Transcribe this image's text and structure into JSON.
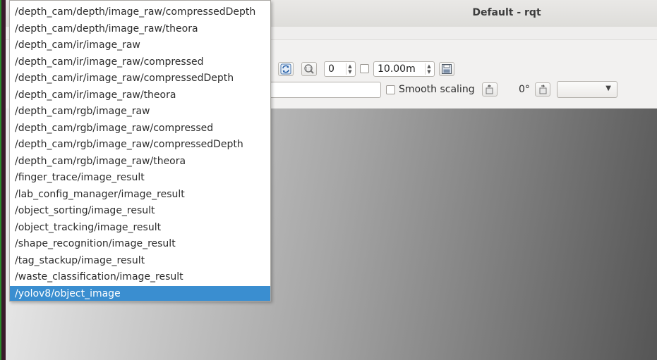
{
  "window": {
    "title": "Default - rqt"
  },
  "toolbar": {
    "refresh_icon": "refresh-icon",
    "zoom_icon": "zoom-icon",
    "spin_value": "0",
    "duration_value": "10.00m",
    "save_icon": "save-icon",
    "smooth_scaling_label": "Smooth scaling",
    "rotate_left_icon": "rotate-left-icon",
    "rotation_label": "0°",
    "rotate_right_icon": "rotate-right-icon",
    "combo_value": ""
  },
  "topic_dropdown": {
    "items": [
      "/depth_cam/depth/image_raw/compressedDepth",
      "/depth_cam/depth/image_raw/theora",
      "/depth_cam/ir/image_raw",
      "/depth_cam/ir/image_raw/compressed",
      "/depth_cam/ir/image_raw/compressedDepth",
      "/depth_cam/ir/image_raw/theora",
      "/depth_cam/rgb/image_raw",
      "/depth_cam/rgb/image_raw/compressed",
      "/depth_cam/rgb/image_raw/compressedDepth",
      "/depth_cam/rgb/image_raw/theora",
      "/finger_trace/image_result",
      "/lab_config_manager/image_result",
      "/object_sorting/image_result",
      "/object_tracking/image_result",
      "/shape_recognition/image_result",
      "/tag_stackup/image_result",
      "/waste_classification/image_result",
      "/yolov8/object_image"
    ],
    "selected": "/yolov8/object_image"
  },
  "colors": {
    "selection": "#3a8ed0",
    "window_bg": "#f2f1f0"
  }
}
